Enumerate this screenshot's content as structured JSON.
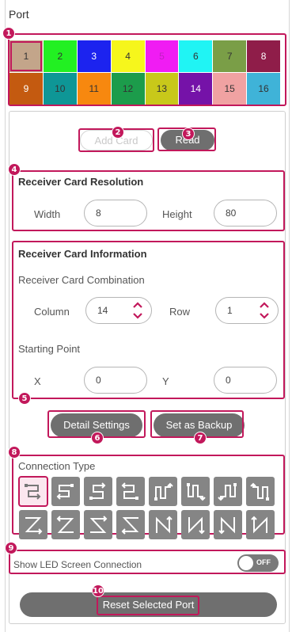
{
  "panel": {
    "title": "Port"
  },
  "ports": [
    {
      "num": "1",
      "color": "#c3a58a",
      "text": "#333333",
      "selected": true
    },
    {
      "num": "2",
      "color": "#22f022",
      "text": "#333333"
    },
    {
      "num": "3",
      "color": "#1c23ef",
      "text": "#ffffff"
    },
    {
      "num": "4",
      "color": "#f6f61c",
      "text": "#333333"
    },
    {
      "num": "5",
      "color": "#f01cf3",
      "text": "#c01fc1"
    },
    {
      "num": "6",
      "color": "#20f4f4",
      "text": "#333333"
    },
    {
      "num": "7",
      "color": "#7a9e47",
      "text": "#333333"
    },
    {
      "num": "8",
      "color": "#8f1d49",
      "text": "#ffffff"
    },
    {
      "num": "9",
      "color": "#c45a10",
      "text": "#ffffff"
    },
    {
      "num": "10",
      "color": "#0e9696",
      "text": "#333333"
    },
    {
      "num": "11",
      "color": "#f7880f",
      "text": "#333333"
    },
    {
      "num": "12",
      "color": "#1c9c4b",
      "text": "#333333"
    },
    {
      "num": "13",
      "color": "#c8c81a",
      "text": "#333333"
    },
    {
      "num": "14",
      "color": "#7512a8",
      "text": "#ffffff"
    },
    {
      "num": "15",
      "color": "#f0a2a2",
      "text": "#333333"
    },
    {
      "num": "16",
      "color": "#3fb3d8",
      "text": "#333333"
    }
  ],
  "buttons": {
    "add_card": "Add Card",
    "read": "Read",
    "detail_settings": "Detail Settings",
    "set_as_backup": "Set as Backup",
    "reset_selected_port": "Reset Selected Port"
  },
  "resolution": {
    "title": "Receiver Card Resolution",
    "width_label": "Width",
    "width_value": "8",
    "height_label": "Height",
    "height_value": "80"
  },
  "information": {
    "title": "Receiver Card Information",
    "combination_label": "Receiver Card Combination",
    "column_label": "Column",
    "column_value": "14",
    "row_label": "Row",
    "row_value": "1",
    "starting_point_label": "Starting Point",
    "x_label": "X",
    "x_value": "0",
    "y_label": "Y",
    "y_value": "0"
  },
  "connection": {
    "title": "Connection Type",
    "types": [
      {
        "icon": "snake-left-down-icon",
        "selected": true
      },
      {
        "icon": "snake-right-down-icon"
      },
      {
        "icon": "snake-left-up-icon"
      },
      {
        "icon": "snake-right-up-icon"
      },
      {
        "icon": "column-snake-up-icon"
      },
      {
        "icon": "column-snake-down-icon"
      },
      {
        "icon": "column-snake-down-alt-icon"
      },
      {
        "icon": "column-snake-up-alt-icon"
      },
      {
        "icon": "zigzag-right-icon"
      },
      {
        "icon": "zigzag-left-up-icon"
      },
      {
        "icon": "zigzag-right-up-icon"
      },
      {
        "icon": "zigzag-left-icon"
      },
      {
        "icon": "column-zigzag-up-icon"
      },
      {
        "icon": "column-zigzag-down-icon"
      },
      {
        "icon": "column-zigzag-down-alt-icon"
      },
      {
        "icon": "column-zigzag-up-alt-icon"
      }
    ]
  },
  "show_connection": {
    "label": "Show LED Screen Connection",
    "state": "OFF"
  },
  "annotations": [
    "1",
    "2",
    "3",
    "4",
    "5",
    "6",
    "7",
    "8",
    "9",
    "10"
  ],
  "colors": {
    "accent": "#c2185b",
    "button": "#6f6f6f",
    "icon_bg": "#858585"
  }
}
